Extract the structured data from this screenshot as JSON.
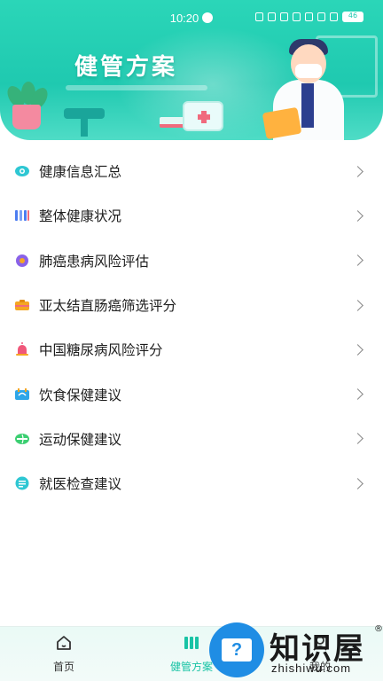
{
  "status_bar": {
    "time": "10:20",
    "battery": "46"
  },
  "header": {
    "title": "健管方案"
  },
  "menu": {
    "items": [
      {
        "label": "健康信息汇总",
        "icon": "eye-icon",
        "color": "#2ec7d3"
      },
      {
        "label": "整体健康状况",
        "icon": "bars-icon",
        "color": "#4c7df0"
      },
      {
        "label": "肺癌患病风险评估",
        "icon": "lung-icon",
        "color": "#8a62e8"
      },
      {
        "label": "亚太结直肠癌筛选评分",
        "icon": "briefcase-icon",
        "color": "#f5a623"
      },
      {
        "label": "中国糖尿病风险评分",
        "icon": "alarm-icon",
        "color": "#f0577a"
      },
      {
        "label": "饮食保健建议",
        "icon": "food-icon",
        "color": "#2ea6e8"
      },
      {
        "label": "运动保健建议",
        "icon": "sport-icon",
        "color": "#3ccf72"
      },
      {
        "label": "就医检查建议",
        "icon": "checklist-icon",
        "color": "#2ec7d3"
      }
    ]
  },
  "bottom_nav": {
    "home": "首页",
    "plan": "健管方案",
    "mine": "我的"
  },
  "watermark": {
    "text": "知识屋",
    "reg": "®",
    "domain": "zhishiwu.com",
    "glyph": "?"
  },
  "colors": {
    "accent": "#19c3a5",
    "banner": "#1fc9b0"
  }
}
